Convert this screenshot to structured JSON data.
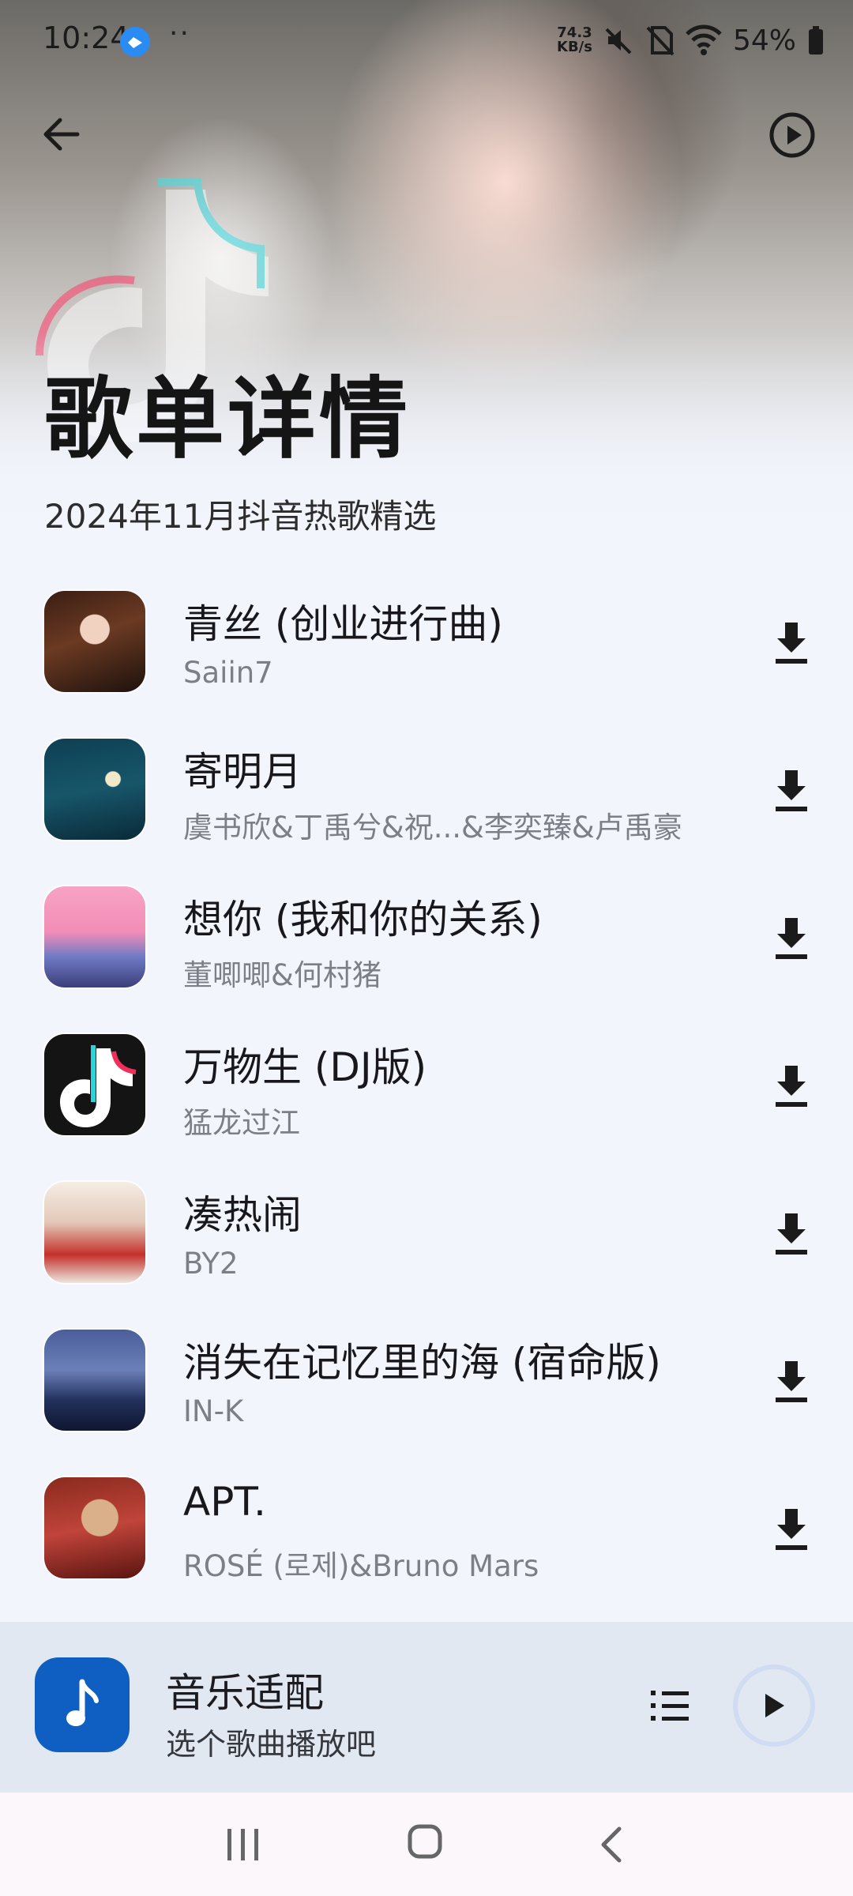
{
  "status_bar": {
    "time": "10:24",
    "dots": "··",
    "net_speed_value": "74.3",
    "net_speed_unit": "KB/s",
    "battery": "54%"
  },
  "header": {
    "title": "歌单详情",
    "subtitle": "2024年11月抖音热歌精选"
  },
  "songs": [
    {
      "title": "青丝 (创业进行曲)",
      "artist": "Saiin7"
    },
    {
      "title": "寄明月",
      "artist": "虞书欣&丁禹兮&祝...&李奕臻&卢禹豪"
    },
    {
      "title": "想你 (我和你的关系)",
      "artist": "董唧唧&何村猪"
    },
    {
      "title": "万物生 (DJ版)",
      "artist": "猛龙过江"
    },
    {
      "title": "凑热闹",
      "artist": "BY2"
    },
    {
      "title": "消失在记忆里的海 (宿命版)",
      "artist": "IN-K"
    },
    {
      "title": "APT.",
      "artist": "ROSÉ (로제)&Bruno Mars"
    }
  ],
  "mini_player": {
    "title": "音乐适配",
    "subtitle": "选个歌曲播放吧"
  },
  "colors": {
    "background": "#f2f5fc",
    "mini_player_bg": "#e2e8f2",
    "app_icon_blue": "#0f5fc3",
    "secondary_text": "#7c7f88"
  }
}
